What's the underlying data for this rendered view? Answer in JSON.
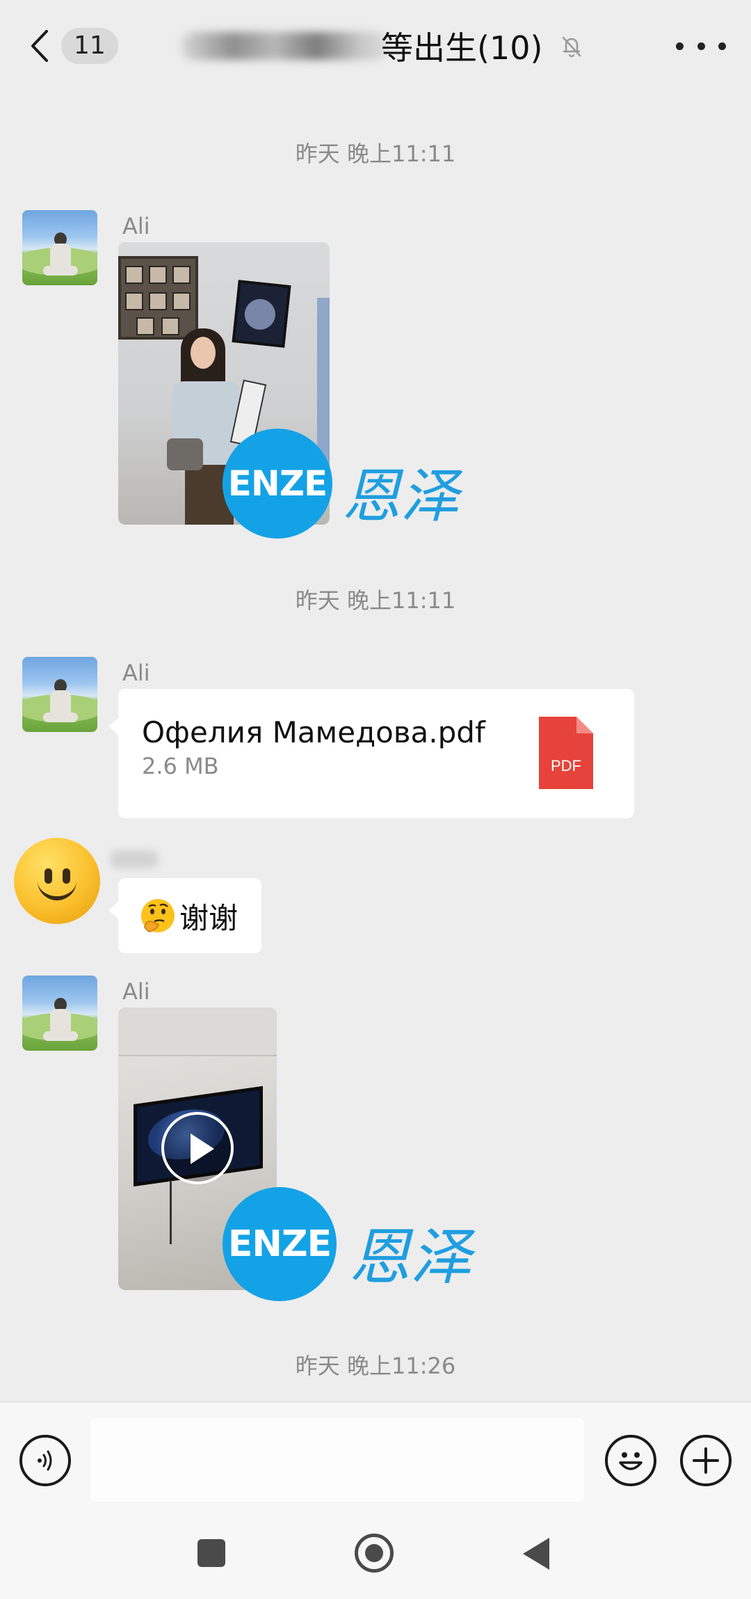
{
  "header": {
    "unread_count": "11",
    "title": "等出生(10)",
    "mute_icon": "bell-off-icon",
    "more_icon": "more-dots-icon"
  },
  "messages": {
    "time_1": "昨天 晚上11:11",
    "time_2": "昨天 晚上11:11",
    "time_3": "昨天 晚上11:26",
    "sender_1": "Ali",
    "sender_2": "Ali",
    "sender_3": "Ali",
    "file": {
      "name": "Офелия Мамедова.pdf",
      "size": "2.6 MB",
      "type_label": "PDF"
    },
    "text_reply": "谢谢",
    "reply_emoji": "thinking-face-icon"
  },
  "watermark": {
    "en": "ENZE",
    "cn": "恩泽"
  },
  "input": {
    "placeholder": "",
    "voice_icon": "voice-icon",
    "emoji_icon": "smile-icon",
    "plus_icon": "plus-icon"
  },
  "colors": {
    "background": "#ededed",
    "bubble": "#ffffff",
    "pdf_red": "#e5433b",
    "watermark_blue": "#14a2e6"
  }
}
